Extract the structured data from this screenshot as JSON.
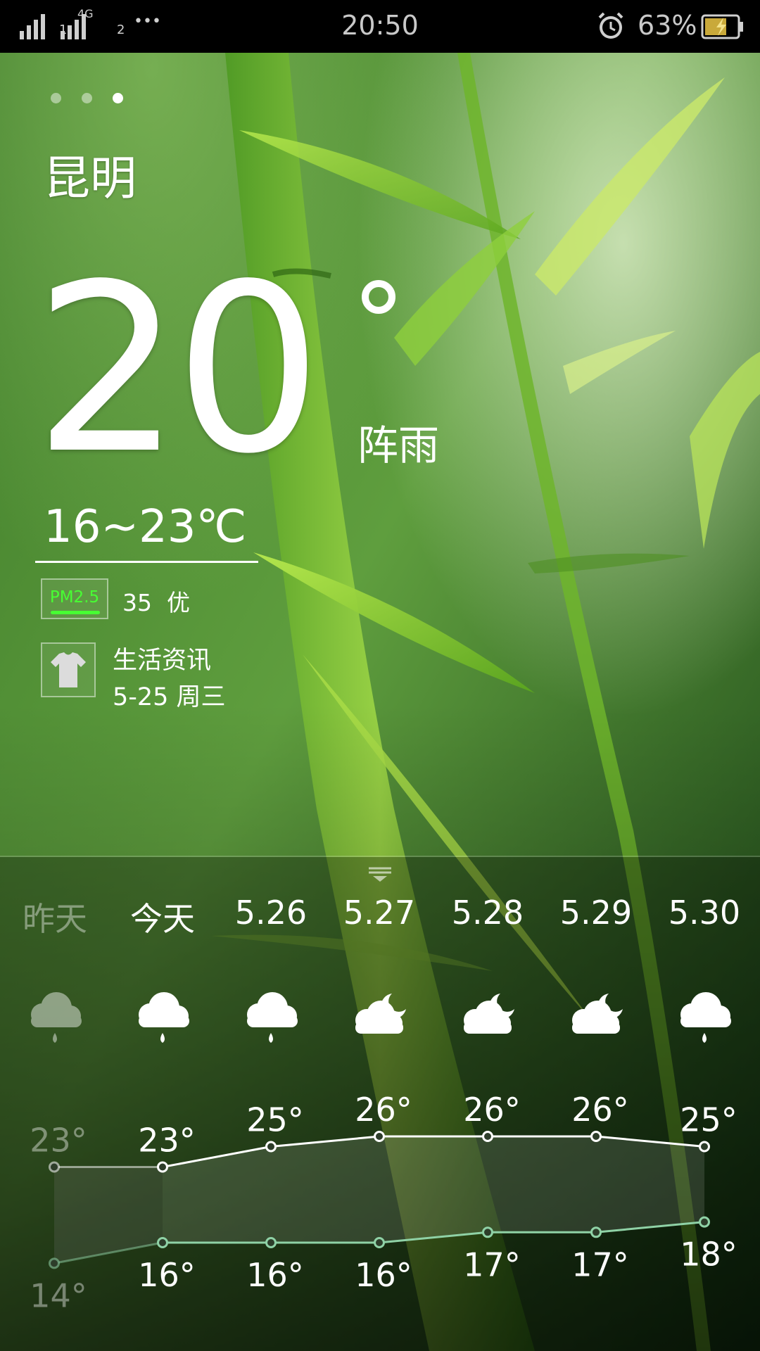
{
  "status_bar": {
    "network": "4G",
    "sim1": "1",
    "sim2": "2",
    "more": "•••",
    "time": "20:50",
    "battery_percent": "63%",
    "icons": [
      "signal-icon",
      "alarm-icon",
      "battery-charging-icon"
    ]
  },
  "pager": {
    "pages": 3,
    "active": 2
  },
  "city": "昆明",
  "current": {
    "temp": "20",
    "condition": "阵雨",
    "range": "16~23℃"
  },
  "pm25": {
    "label": "PM2.5",
    "value": "35",
    "level": "优"
  },
  "life": {
    "title": "生活资讯",
    "date": "5-25 周三",
    "icon": "tshirt-icon"
  },
  "forecast": {
    "days": [
      "昨天",
      "今天",
      "5.26",
      "5.27",
      "5.28",
      "5.29",
      "5.30"
    ],
    "icons": [
      "rain-cloud-icon",
      "rain-cloud-icon",
      "rain-cloud-icon",
      "partly-cloudy-night-icon",
      "partly-cloudy-night-icon",
      "partly-cloudy-night-icon",
      "rain-cloud-icon"
    ],
    "highs": [
      "23°",
      "23°",
      "25°",
      "26°",
      "26°",
      "26°",
      "25°"
    ],
    "lows": [
      "14°",
      "16°",
      "16°",
      "16°",
      "17°",
      "17°",
      "18°"
    ]
  },
  "chart_data": {
    "type": "line",
    "categories": [
      "昨天",
      "今天",
      "5.26",
      "5.27",
      "5.28",
      "5.29",
      "5.30"
    ],
    "series": [
      {
        "values": [
          23,
          23,
          25,
          26,
          26,
          26,
          25
        ]
      },
      {
        "values": [
          14,
          16,
          16,
          16,
          17,
          17,
          18
        ]
      }
    ]
  },
  "colors": {
    "pm_accent": "#47ff33",
    "high_line": "#ffffff",
    "low_line": "#8fd2a6"
  }
}
